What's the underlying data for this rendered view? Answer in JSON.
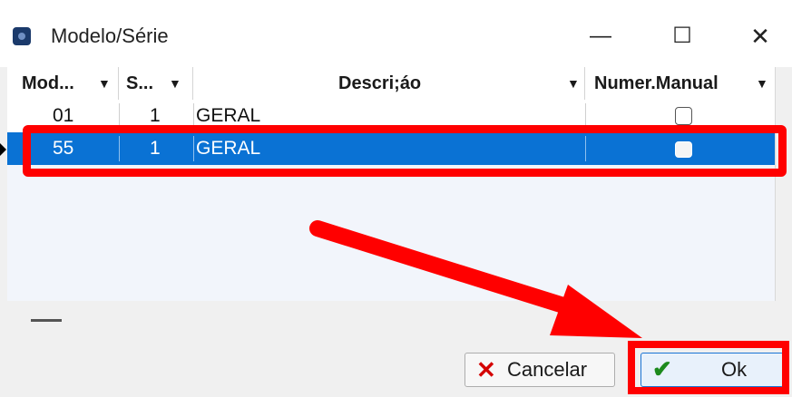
{
  "window": {
    "title": "Modelo/Série",
    "minimize": "—",
    "maximize": "☐",
    "close": "✕"
  },
  "grid": {
    "columns": [
      {
        "label": "Mod..."
      },
      {
        "label": "S..."
      },
      {
        "label": "Descri;áo"
      },
      {
        "label": "Numer.Manual"
      }
    ],
    "dropdown_glyph": "▼",
    "rows": [
      {
        "modelo": "01",
        "serie": "1",
        "descricao": "GERAL",
        "numer_manual": false,
        "selected": false
      },
      {
        "modelo": "55",
        "serie": "1",
        "descricao": "GERAL",
        "numer_manual": false,
        "selected": true
      }
    ]
  },
  "buttons": {
    "cancel": {
      "label": "Cancelar",
      "icon": "x-icon"
    },
    "ok": {
      "label": "Ok",
      "icon": "checkmark-icon"
    }
  },
  "colors": {
    "selection": "#0a72d4",
    "annotation": "#ff0000"
  }
}
